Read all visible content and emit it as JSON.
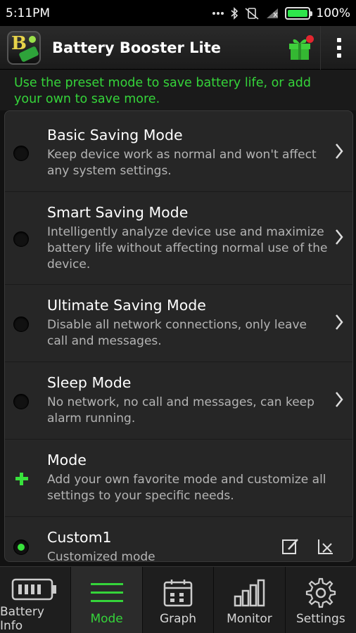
{
  "status_bar": {
    "time": "5:11PM",
    "battery_percent": "100%",
    "battery_level": 1.0,
    "icons": [
      "more-dots-icon",
      "bluetooth-icon",
      "vibrate-off-icon",
      "signal-icon",
      "battery-icon"
    ]
  },
  "app_bar": {
    "title": "Battery Booster Lite",
    "icons": [
      "app-logo-icon",
      "gift-icon",
      "overflow-menu-icon"
    ]
  },
  "hint": "Use the preset mode to save battery life, or add your own to save more.",
  "modes": [
    {
      "title": "Basic Saving Mode",
      "desc": "Keep device work as normal and won't affect any system settings."
    },
    {
      "title": "Smart Saving Mode",
      "desc": "Intelligently analyze device use and maximize battery life without affecting normal use of the device."
    },
    {
      "title": "Ultimate Saving Mode",
      "desc": "Disable all network connections, only leave call and messages."
    },
    {
      "title": "Sleep Mode",
      "desc": "No network, no call and messages, can keep alarm running."
    },
    {
      "title": "Mode",
      "desc": "Add your own favorite mode and customize all settings to your specific needs."
    },
    {
      "title": "Custom1",
      "desc": "Customized mode"
    }
  ],
  "bottom_nav": [
    {
      "label": "Battery Info",
      "icon": "battery-info-icon"
    },
    {
      "label": "Mode",
      "icon": "list-icon"
    },
    {
      "label": "Graph",
      "icon": "calendar-graph-icon"
    },
    {
      "label": "Monitor",
      "icon": "bar-chart-icon"
    },
    {
      "label": "Settings",
      "icon": "gear-icon"
    }
  ],
  "colors": {
    "accent_green": "#35d43a",
    "background": "#121212",
    "card": "#262626",
    "badge_red": "#e3262f"
  }
}
